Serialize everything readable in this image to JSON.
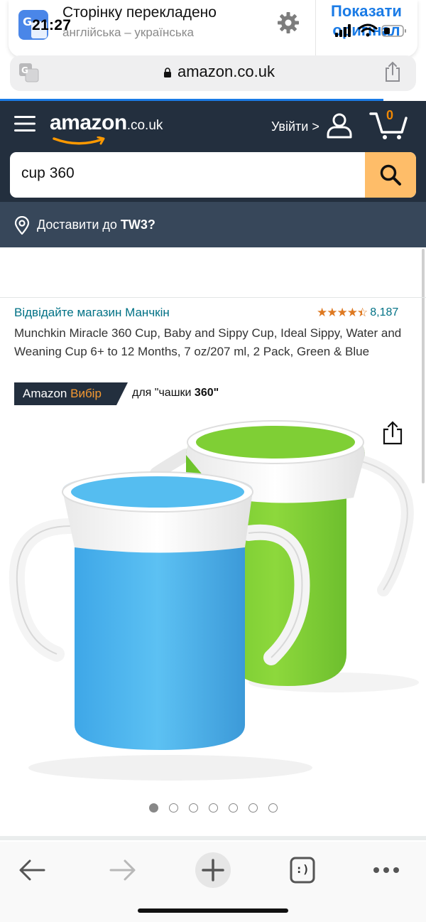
{
  "status_bar": {
    "time": "21:27"
  },
  "translate_banner": {
    "title": "Сторінку перекладено",
    "languages": "англійська – українська",
    "show_original": "Показати оригінал",
    "icons": [
      "translate-icon",
      "gear-icon"
    ]
  },
  "browser": {
    "url": "amazon.co.uk",
    "load_progress": 0.9,
    "toolbar": {
      "tab_count_label": ":)",
      "icons": [
        "back-arrow-icon",
        "forward-arrow-icon",
        "new-tab-plus-icon",
        "tabs-icon",
        "more-icon"
      ]
    }
  },
  "header": {
    "logo_main": "amazon",
    "logo_tld": ".co.uk",
    "sign_in": "Увійти >",
    "cart_count": "0",
    "search_value": "cup 360",
    "deliver_prefix": "Доставити до",
    "deliver_postcode": "TW3?"
  },
  "product": {
    "store_link": "Відвідайте магазин Манчкін",
    "rating_stars": 4.5,
    "rating_count": "8,187",
    "title": "Munchkin Miracle 360 Cup, Baby and Sippy Cup, Ideal Sippy, Water and Weaning Cup 6+ to 12 Months, 7 oz/207 ml, 2 Pack, Green & Blue",
    "badge_amazon": "Amazon",
    "badge_choice": "Вибір",
    "badge_for_prefix": "для \"чашки",
    "badge_for_bold": "360\"",
    "image_dots": 7,
    "active_image": 1
  },
  "colors": {
    "header_bg": "#232f3e",
    "deliver_bg": "#37475a",
    "search_button": "#febd69",
    "link": "#007185",
    "star": "#de7921",
    "ios_blue": "#1a7be6",
    "cup_blue": "#4fb6ee",
    "cup_green": "#7fcf35"
  }
}
